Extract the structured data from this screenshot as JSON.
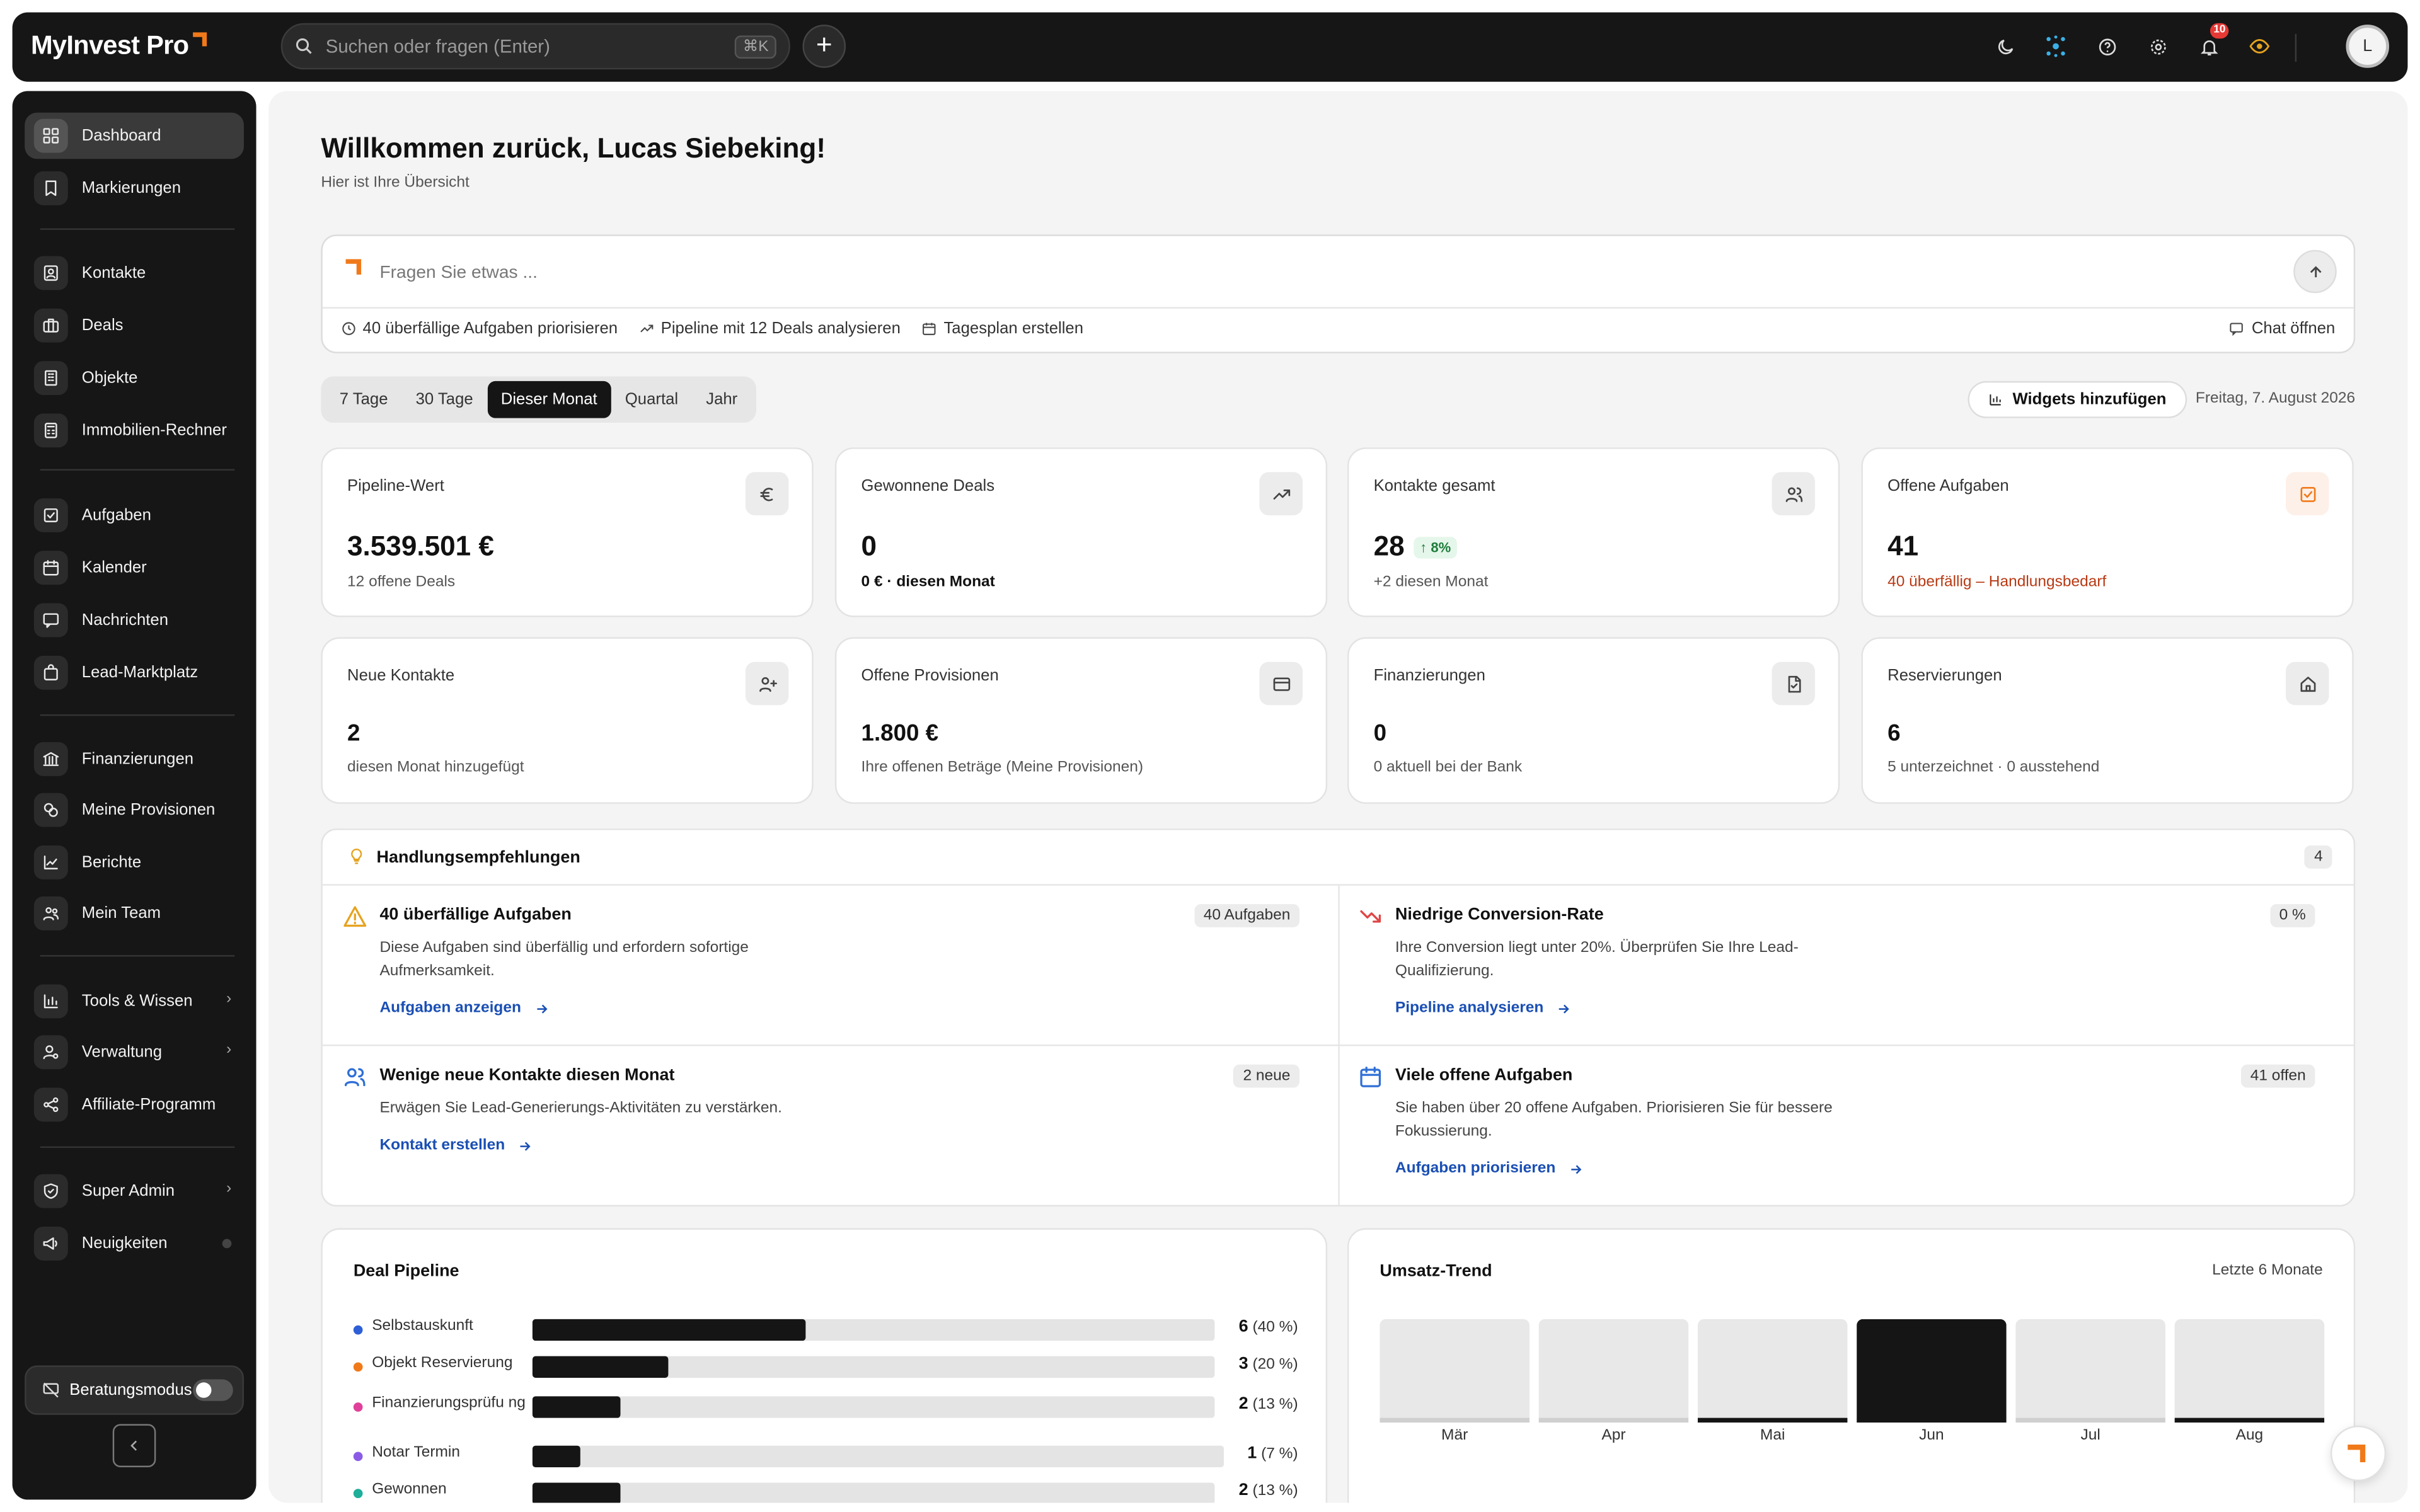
{
  "app": {
    "name": "MyInvest Pro"
  },
  "search": {
    "placeholder": "Suchen oder fragen (Enter)",
    "shortcut": "⌘K"
  },
  "topbar": {
    "notification_count": "10",
    "avatar_initial": "L"
  },
  "sidebar": {
    "items": [
      {
        "label": "Dashboard",
        "icon": "dashboard-icon"
      },
      {
        "label": "Markierungen",
        "icon": "bookmark-icon"
      },
      {
        "label": "Kontakte",
        "icon": "contact-icon"
      },
      {
        "label": "Deals",
        "icon": "briefcase-icon"
      },
      {
        "label": "Objekte",
        "icon": "building-icon"
      },
      {
        "label": "Immobilien-Rechner",
        "icon": "calculator-icon"
      },
      {
        "label": "Aufgaben",
        "icon": "checkbox-icon"
      },
      {
        "label": "Kalender",
        "icon": "calendar-icon"
      },
      {
        "label": "Nachrichten",
        "icon": "message-icon"
      },
      {
        "label": "Lead-Marktplatz",
        "icon": "shopping-bag-icon"
      },
      {
        "label": "Finanzierungen",
        "icon": "bank-icon"
      },
      {
        "label": "Meine Provisionen",
        "icon": "coins-icon"
      },
      {
        "label": "Berichte",
        "icon": "chart-icon"
      },
      {
        "label": "Mein Team",
        "icon": "team-icon"
      },
      {
        "label": "Tools & Wissen",
        "icon": "bar-chart-icon"
      },
      {
        "label": "Verwaltung",
        "icon": "user-cog-icon"
      },
      {
        "label": "Affiliate-Programm",
        "icon": "share-icon"
      },
      {
        "label": "Super Admin",
        "icon": "shield-icon"
      },
      {
        "label": "Neuigkeiten",
        "icon": "megaphone-icon"
      }
    ],
    "beratung_label": "Beratungsmodus"
  },
  "header": {
    "welcome": "Willkommen zurück, Lucas Siebeking!",
    "subtitle": "Hier ist Ihre Übersicht"
  },
  "ask": {
    "placeholder": "Fragen Sie etwas ...",
    "actions": [
      "40 überfällige Aufgaben priorisieren",
      "Pipeline mit 12 Deals analysieren",
      "Tagesplan erstellen"
    ],
    "chat_open": "Chat öffnen"
  },
  "range_tabs": [
    "7 Tage",
    "30 Tage",
    "Dieser Monat",
    "Quartal",
    "Jahr"
  ],
  "range_active": "Dieser Monat",
  "widgets_button": "Widgets hinzufügen",
  "date": "Freitag, 7. August 2026",
  "kpis": [
    {
      "title": "Pipeline-Wert",
      "value": "3.539.501 €",
      "sub": "12 offene Deals",
      "icon": "euro-icon"
    },
    {
      "title": "Gewonnene Deals",
      "value": "0",
      "sub": "0 € · diesen Monat",
      "icon": "trending-up-icon"
    },
    {
      "title": "Kontakte gesamt",
      "value": "28",
      "badge": "8%",
      "sub": "+2 diesen Monat",
      "icon": "users-icon"
    },
    {
      "title": "Offene Aufgaben",
      "value": "41",
      "sub": "40 überfällig – Handlungsbedarf",
      "icon": "task-icon"
    },
    {
      "title": "Neue Kontakte",
      "value": "2",
      "sub": "diesen Monat hinzugefügt",
      "icon": "user-plus-icon"
    },
    {
      "title": "Offene Provisionen",
      "value": "1.800 €",
      "sub": "Ihre offenen Beträge (Meine Provisionen)",
      "icon": "credit-card-icon"
    },
    {
      "title": "Finanzierungen",
      "value": "0",
      "sub": "0 aktuell bei der Bank",
      "icon": "document-icon"
    },
    {
      "title": "Reservierungen",
      "value": "6",
      "sub": "5 unterzeichnet · 0 ausstehend",
      "icon": "home-icon"
    }
  ],
  "recommendations": {
    "title": "Handlungsempfehlungen",
    "count": "4",
    "items": [
      {
        "title": "40 überfällige Aufgaben",
        "desc": "Diese Aufgaben sind überfällig und erfordern sofortige Aufmerksamkeit.",
        "link": "Aufgaben anzeigen",
        "tag": "40 Aufgaben",
        "icon": "warning-icon"
      },
      {
        "title": "Niedrige Conversion-Rate",
        "desc": "Ihre Conversion liegt unter 20%. Überprüfen Sie Ihre Lead-Qualifizierung.",
        "link": "Pipeline analysieren",
        "tag": "0 %",
        "icon": "trending-down-icon"
      },
      {
        "title": "Wenige neue Kontakte diesen Monat",
        "desc": "Erwägen Sie Lead-Generierungs-Aktivitäten zu verstärken.",
        "link": "Kontakt erstellen",
        "tag": "2 neue",
        "icon": "users-icon"
      },
      {
        "title": "Viele offene Aufgaben",
        "desc": "Sie haben über 20 offene Aufgaben. Priorisieren Sie für bessere Fokussierung.",
        "link": "Aufgaben priorisieren",
        "tag": "41 offen",
        "icon": "calendar-icon"
      }
    ]
  },
  "pipeline": {
    "title": "Deal Pipeline",
    "stages": [
      {
        "label": "Selbstauskunft",
        "count": "6",
        "pct": "(40 %)",
        "value": 40,
        "color": "#2f5fd6"
      },
      {
        "label": "Objekt Reservierung",
        "count": "3",
        "pct": "(20 %)",
        "value": 20,
        "color": "#f07a1a"
      },
      {
        "label": "Finanzierungsprüfu ng",
        "count": "2",
        "pct": "(13 %)",
        "value": 13,
        "color": "#e0409a"
      },
      {
        "label": "Notar Termin",
        "count": "1",
        "pct": "(7 %)",
        "value": 7,
        "color": "#8a5ce6"
      },
      {
        "label": "Gewonnen",
        "count": "2",
        "pct": "(13 %)",
        "value": 13,
        "color": "#1fae9a"
      }
    ]
  },
  "chart_data": {
    "type": "bar",
    "title": "Umsatz-Trend",
    "subtitle": "Letzte 6 Monate",
    "categories": [
      "Mär",
      "Apr",
      "Mai",
      "Jun",
      "Jul",
      "Aug"
    ],
    "values": [
      0,
      0,
      0.05,
      1,
      0,
      0.05
    ],
    "ylim": [
      0,
      1
    ],
    "grid": false
  },
  "colors": {
    "accent": "#f07a1a",
    "dark": "#161616",
    "link": "#1a4fb4",
    "danger": "#b83a14"
  }
}
